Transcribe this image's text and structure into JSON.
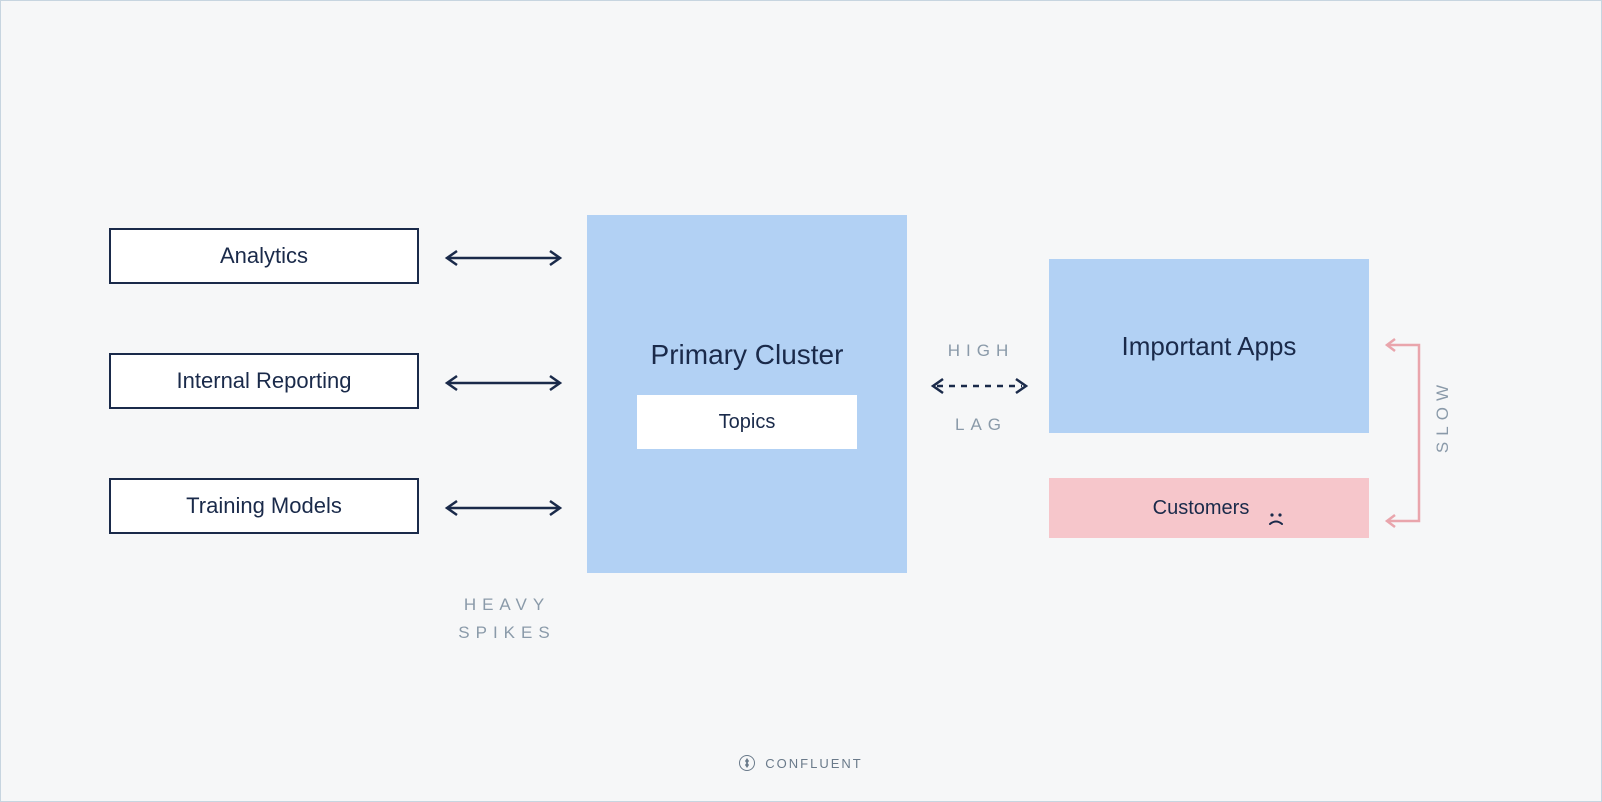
{
  "leftBoxes": {
    "analytics": "Analytics",
    "internalReporting": "Internal Reporting",
    "trainingModels": "Training Models"
  },
  "cluster": {
    "title": "Primary Cluster",
    "topics": "Topics"
  },
  "rightBoxes": {
    "importantApps": "Important Apps",
    "customers": "Customers"
  },
  "labels": {
    "heavySpikes1": "HEAVY",
    "heavySpikes2": "SPIKES",
    "highLag1": "HIGH",
    "highLag2": "LAG",
    "slow": "SLOW"
  },
  "footer": {
    "brand": "CONFLUENT"
  }
}
